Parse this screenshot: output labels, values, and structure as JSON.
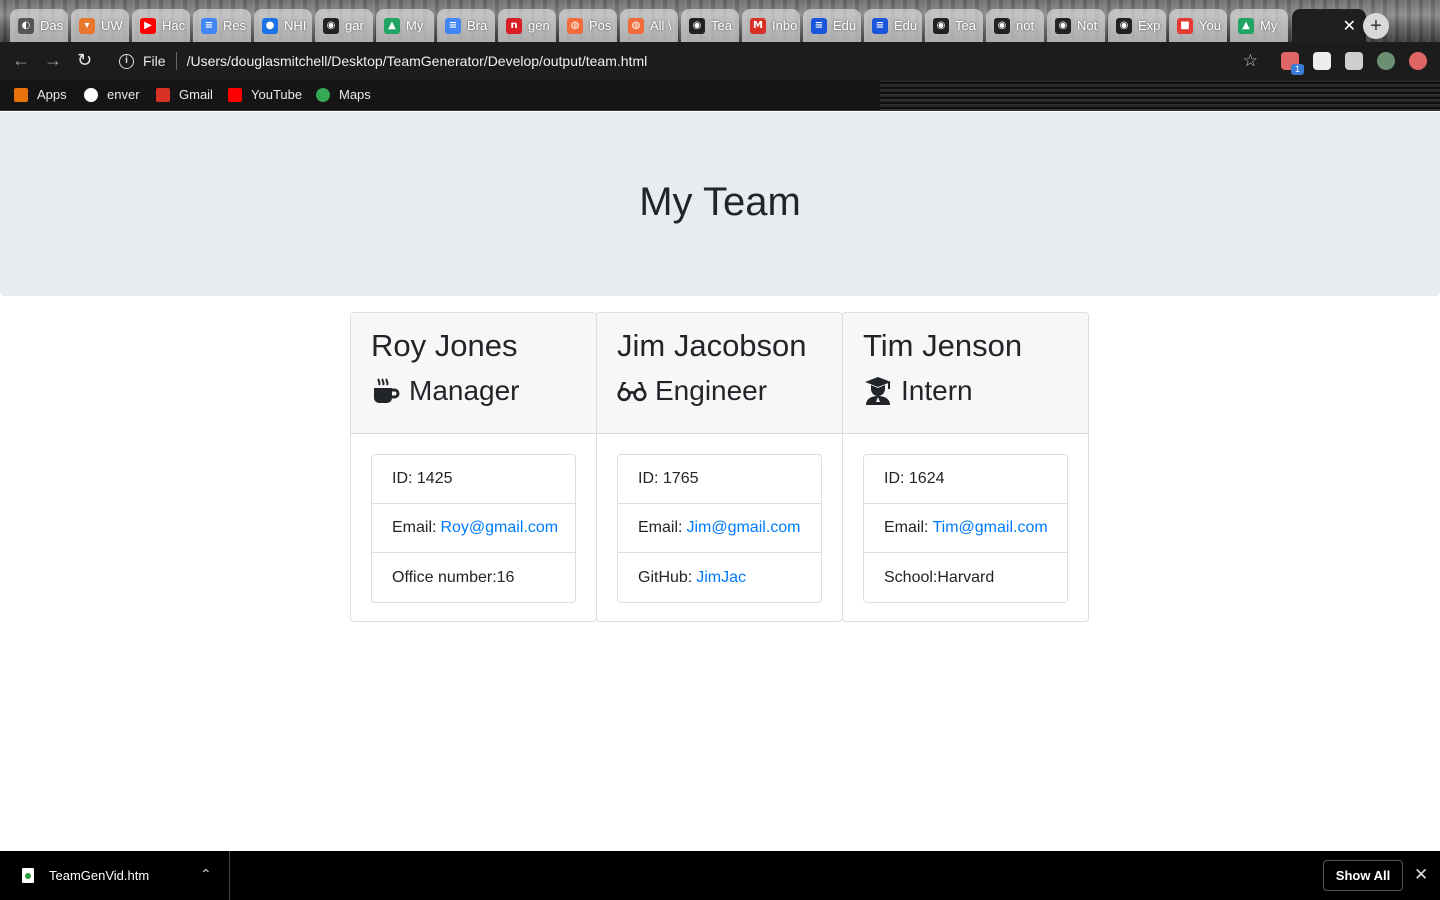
{
  "browser": {
    "tabs": [
      {
        "label": "Das",
        "color": "#555555",
        "glyph": "◐"
      },
      {
        "label": "UW",
        "color": "#e8762d",
        "glyph": "▾"
      },
      {
        "label": "Hac",
        "color": "#ff0000",
        "glyph": "▶"
      },
      {
        "label": "Res",
        "color": "#4285f4",
        "glyph": "≡"
      },
      {
        "label": "NHI",
        "color": "#1a73e8",
        "glyph": "●"
      },
      {
        "label": "gar",
        "color": "#222222",
        "glyph": "◉"
      },
      {
        "label": "My",
        "color": "#1fa463",
        "glyph": "▲"
      },
      {
        "label": "Bra",
        "color": "#4285f4",
        "glyph": "≡"
      },
      {
        "label": "gen",
        "color": "#d81f26",
        "glyph": "n"
      },
      {
        "label": "Pos",
        "color": "#f26b3a",
        "glyph": "◍"
      },
      {
        "label": "All \\",
        "color": "#f26b3a",
        "glyph": "◍"
      },
      {
        "label": "Tea",
        "color": "#222222",
        "glyph": "◉"
      },
      {
        "label": "Inbo",
        "color": "#d93025",
        "glyph": "M"
      },
      {
        "label": "Edu",
        "color": "#1a56db",
        "glyph": "≡"
      },
      {
        "label": "Edu",
        "color": "#1a56db",
        "glyph": "≡"
      },
      {
        "label": "Tea",
        "color": "#222222",
        "glyph": "◉"
      },
      {
        "label": "not",
        "color": "#222222",
        "glyph": "◉"
      },
      {
        "label": "Not",
        "color": "#222222",
        "glyph": "◉"
      },
      {
        "label": "Exp",
        "color": "#222222",
        "glyph": "◉"
      },
      {
        "label": "You",
        "color": "#e53935",
        "glyph": "■"
      },
      {
        "label": "My",
        "color": "#1fa463",
        "glyph": "▲"
      }
    ],
    "active_tab_close": "✕",
    "new_tab": "+",
    "nav": {
      "back": "←",
      "forward": "→",
      "reload": "↻"
    },
    "address": {
      "scheme": "File",
      "url": "/Users/douglasmitchell/Desktop/TeamGenerator/Develop/output/team.html",
      "star": "☆"
    },
    "extensions": [
      {
        "icon": "meet-icon",
        "color": "#e06666"
      },
      {
        "icon": "screen-capture-icon",
        "color": "#eeeeee"
      },
      {
        "icon": "puzzle-icon",
        "color": "#cfcfcf"
      },
      {
        "icon": "avatar",
        "color": "#6b8f71"
      },
      {
        "icon": "rocket-extension-icon",
        "color": "#e06666"
      }
    ],
    "extension_badge": "1",
    "bookmarks": [
      {
        "label": "Apps",
        "icon": "apps-grid-icon",
        "color": "#e8710a"
      },
      {
        "label": "enver",
        "icon": "globe-icon",
        "color": "#ffffff"
      },
      {
        "label": "Gmail",
        "icon": "gmail-icon",
        "color": "#d93025"
      },
      {
        "label": "YouTube",
        "icon": "youtube-icon",
        "color": "#ff0000"
      },
      {
        "label": "Maps",
        "icon": "maps-pin-icon",
        "color": "#34a853"
      }
    ]
  },
  "page": {
    "title": "My Team",
    "members": [
      {
        "name": "Roy Jones",
        "role": "Manager",
        "role_icon": "coffee-mug-icon",
        "id_label": "ID:",
        "id": "1425",
        "email_label": "Email:",
        "email": "Roy@gmail.com",
        "extra_label": "Office number:",
        "extra": "16",
        "extra_is_link": false
      },
      {
        "name": "Jim Jacobson",
        "role": "Engineer",
        "role_icon": "glasses-icon",
        "id_label": "ID:",
        "id": "1765",
        "email_label": "Email:",
        "email": "Jim@gmail.com",
        "extra_label": "GitHub:",
        "extra": "JimJac",
        "extra_is_link": true
      },
      {
        "name": "Tim Jenson",
        "role": "Intern",
        "role_icon": "graduate-icon",
        "id_label": "ID:",
        "id": "1624",
        "email_label": "Email:",
        "email": "Tim@gmail.com",
        "extra_label": "School:",
        "extra": "Harvard",
        "extra_is_link": false
      }
    ],
    "colors": {
      "link": "#007bff",
      "jumbotron": "#e9ecef",
      "card_header": "#f7f7f7"
    }
  },
  "downloads": {
    "file": "TeamGenVid.htm",
    "show_all": "Show All",
    "caret": "⌃",
    "close": "✕"
  }
}
